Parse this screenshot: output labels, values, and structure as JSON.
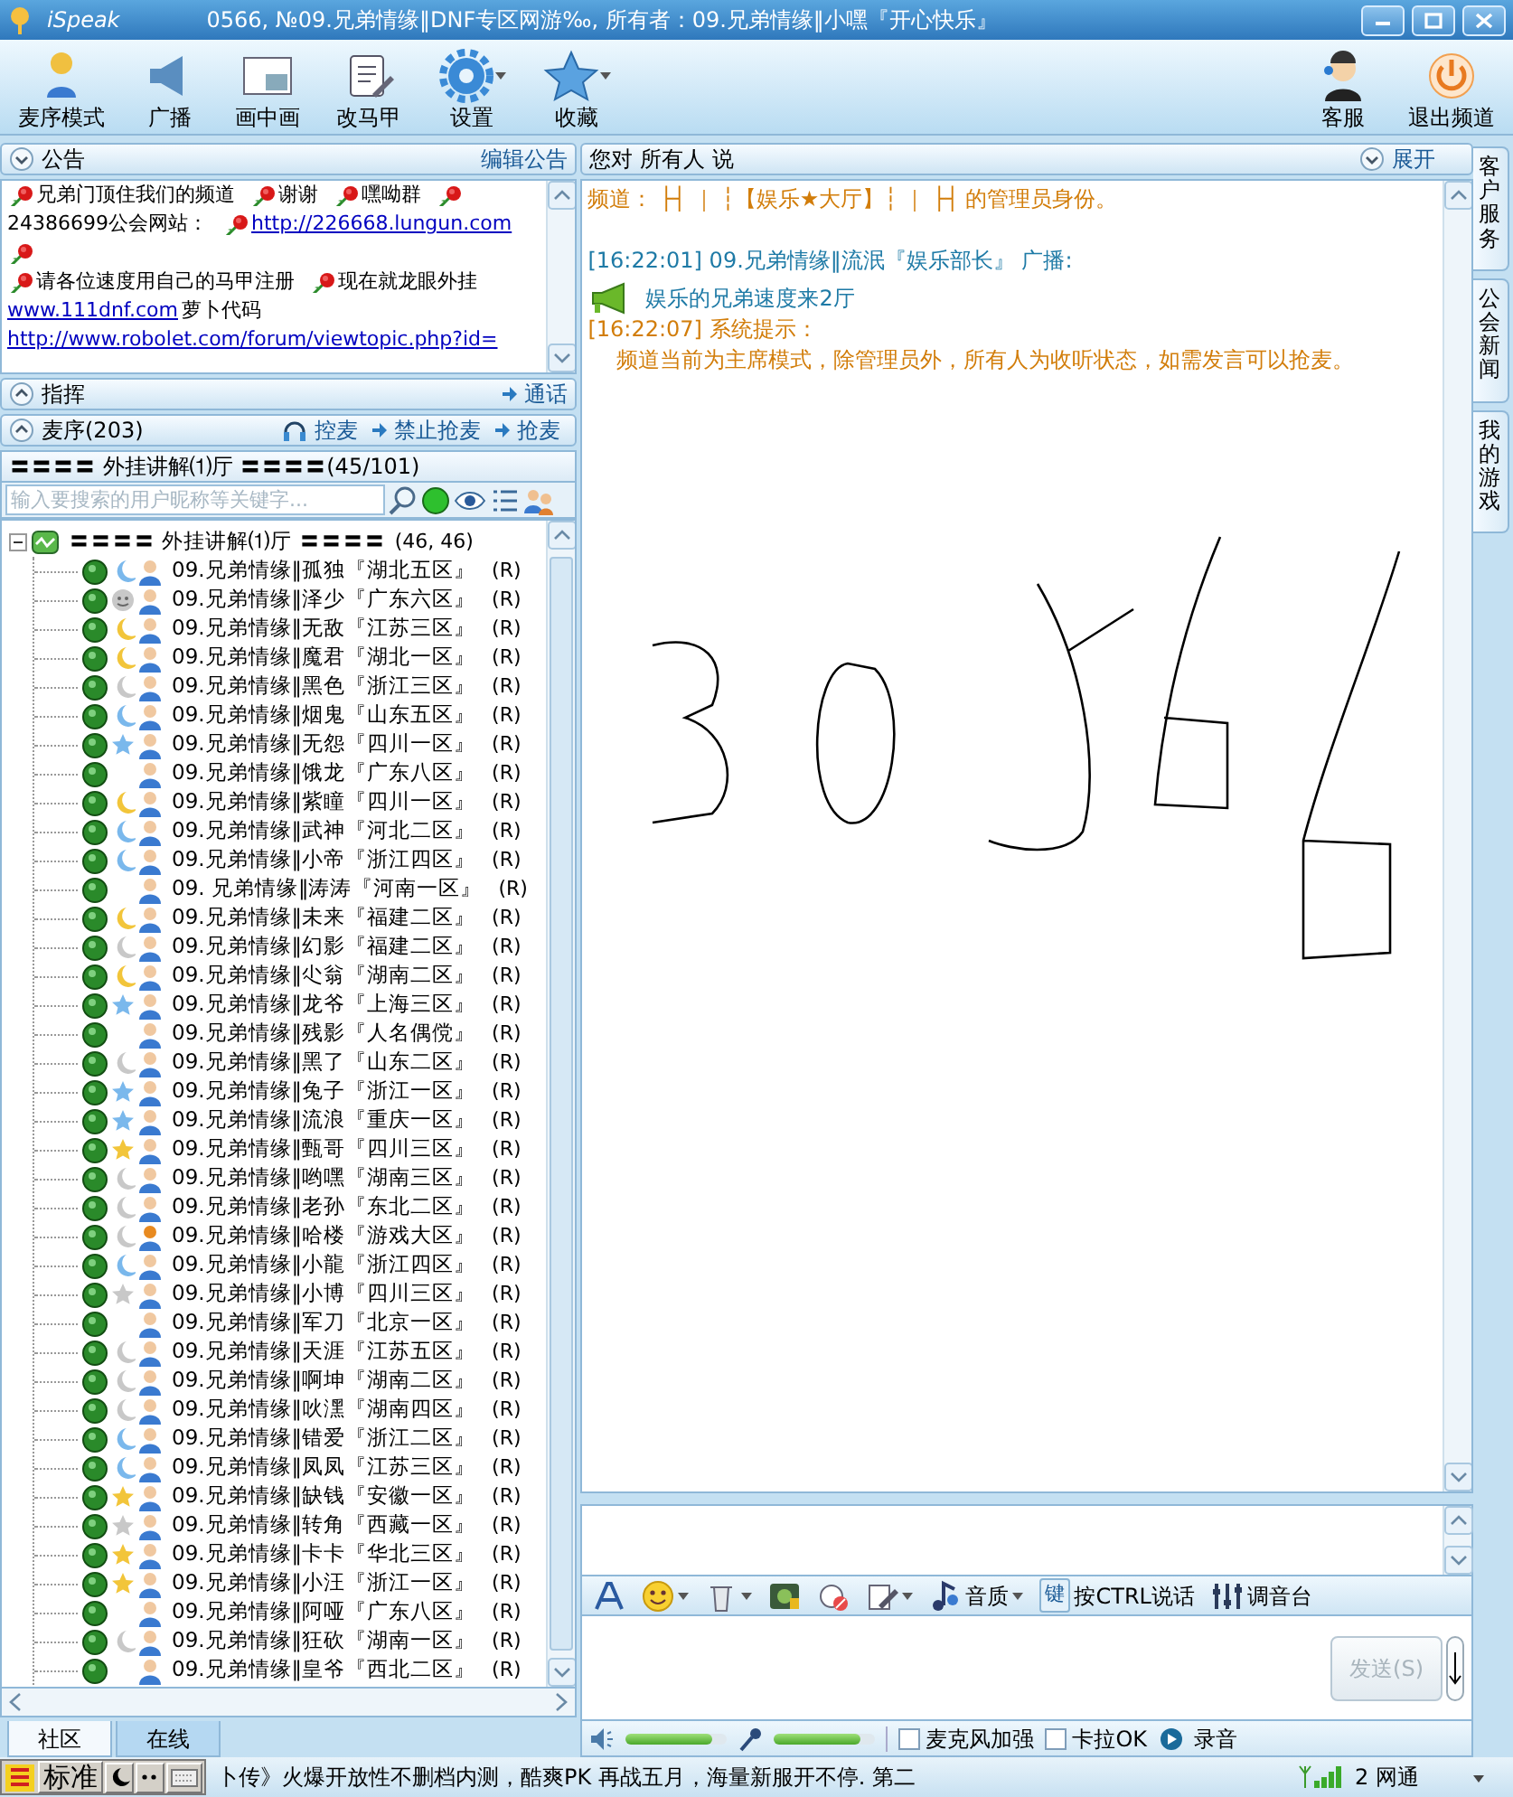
{
  "window": {
    "app_name": "iSpeak",
    "title": "0566, №09.兄弟情缘‖DNF专区网游‰, 所有者：09.兄弟情缘‖小嘿『开心快乐』"
  },
  "toolbar": {
    "left": [
      {
        "kind": "queue",
        "label": "麦序模式",
        "dropdown": false
      },
      {
        "kind": "broadcast",
        "label": "广播",
        "dropdown": false
      },
      {
        "kind": "pip",
        "label": "画中画",
        "dropdown": false
      },
      {
        "kind": "vest",
        "label": "改马甲",
        "dropdown": false
      },
      {
        "kind": "gear",
        "label": "设置",
        "dropdown": true
      },
      {
        "kind": "star",
        "label": "收藏",
        "dropdown": true
      }
    ],
    "right": [
      {
        "kind": "support",
        "label": "客服",
        "dropdown": false
      },
      {
        "kind": "power",
        "label": "退出频道",
        "dropdown": false
      }
    ]
  },
  "announcement": {
    "title": "公告",
    "expanded": true,
    "action": "编辑公告",
    "lines": [
      [
        {
          "kind": "rose"
        },
        {
          "kind": "text",
          "text": "兄弟门顶住我们的频道"
        },
        {
          "kind": "rose"
        },
        {
          "kind": "text",
          "text": "谢谢"
        },
        {
          "kind": "rose"
        },
        {
          "kind": "text",
          "text": "嘿呦群"
        },
        {
          "kind": "rose"
        }
      ],
      [
        {
          "kind": "text",
          "text": "24386699公会网站："
        },
        {
          "kind": "rose"
        },
        {
          "kind": "link",
          "text": "http://226668.lungun.com"
        }
      ],
      [
        {
          "kind": "rose"
        }
      ],
      [
        {
          "kind": "rose"
        },
        {
          "kind": "text",
          "text": "请各位速度用自己的马甲注册"
        },
        {
          "kind": "rose"
        },
        {
          "kind": "text",
          "text": "现在就龙眼外挂"
        }
      ],
      [
        {
          "kind": "link",
          "text": "www.111dnf.com"
        },
        {
          "kind": "text",
          "text": "萝卜代码"
        }
      ],
      [
        {
          "kind": "link",
          "text": "http://www.robolet.com/forum/viewtopic.php?id="
        }
      ]
    ]
  },
  "command": {
    "title": "指挥",
    "expanded": false,
    "action": "通话"
  },
  "queue": {
    "title": "麦序(203)",
    "expanded": false,
    "actions": [
      "控麦",
      "禁止抢麦",
      "抢麦"
    ]
  },
  "channel": {
    "title": "〓〓〓〓 外挂讲解⑴厅 〓〓〓〓(45/101)"
  },
  "search": {
    "placeholder": "输入要搜索的用户昵称等关键字..."
  },
  "tree": {
    "label": "〓〓〓〓 外挂讲解⑴厅 〓〓〓〓",
    "count": "(46, 46)",
    "expanded": true,
    "children": [
      {
        "name": "09.兄弟情缘‖孤独『湖北五区』",
        "tag": "(R)",
        "kind": "moon",
        "color": "#7ab8ec",
        "vip": false
      },
      {
        "name": "09.兄弟情缘‖泽少『广东六区』",
        "tag": "(R)",
        "kind": "smile",
        "color": "#c8c8c8",
        "vip": false
      },
      {
        "name": "09.兄弟情缘‖无敌『江苏三区』",
        "tag": "(R)",
        "kind": "moon",
        "color": "#f2c53a",
        "vip": false
      },
      {
        "name": "09.兄弟情缘‖魔君『湖北一区』",
        "tag": "(R)",
        "kind": "moon",
        "color": "#f2c53a",
        "vip": false
      },
      {
        "name": "09.兄弟情缘‖黑色『浙江三区』",
        "tag": "(R)",
        "kind": "moon",
        "color": "#c8c8c8",
        "vip": false
      },
      {
        "name": "09.兄弟情缘‖烟鬼『山东五区』",
        "tag": "(R)",
        "kind": "moon",
        "color": "#7ab8ec",
        "vip": false
      },
      {
        "name": "09.兄弟情缘‖无怨『四川一区』",
        "tag": "(R)",
        "kind": "star",
        "color": "#7ab8ec",
        "vip": false
      },
      {
        "name": "09.兄弟情缘‖饿龙『广东八区』",
        "tag": "(R)",
        "kind": "plain",
        "vip": false
      },
      {
        "name": "09.兄弟情缘‖紫瞳『四川一区』",
        "tag": "(R)",
        "kind": "moon",
        "color": "#f2c53a",
        "vip": false
      },
      {
        "name": "09.兄弟情缘‖武神『河北二区』",
        "tag": "(R)",
        "kind": "moon",
        "color": "#7ab8ec",
        "vip": false
      },
      {
        "name": "09.兄弟情缘‖小帝『浙江四区』",
        "tag": "(R)",
        "kind": "moon",
        "color": "#7ab8ec",
        "vip": false
      },
      {
        "name": "09. 兄弟情缘‖涛涛『河南一区』",
        "tag": "(R)",
        "kind": "plain",
        "vip": false
      },
      {
        "name": "09.兄弟情缘‖未来『福建二区』",
        "tag": "(R)",
        "kind": "moon",
        "color": "#f2c53a",
        "vip": false
      },
      {
        "name": "09.兄弟情缘‖幻影『福建二区』",
        "tag": "(R)",
        "kind": "moon",
        "color": "#c8c8c8",
        "vip": false
      },
      {
        "name": "09.兄弟情缘‖尐翁『湖南二区』",
        "tag": "(R)",
        "kind": "moon",
        "color": "#f2c53a",
        "vip": false
      },
      {
        "name": "09.兄弟情缘‖龙爷『上海三区』",
        "tag": "(R)",
        "kind": "star",
        "color": "#7ab8ec",
        "vip": false
      },
      {
        "name": "09.兄弟情缘‖残影『人名偶傥』",
        "tag": "(R)",
        "kind": "plain",
        "vip": false
      },
      {
        "name": "09.兄弟情缘‖黑了『山东二区』",
        "tag": "(R)",
        "kind": "moon",
        "color": "#c8c8c8",
        "vip": false
      },
      {
        "name": "09.兄弟情缘‖兔子『浙江一区』",
        "tag": "(R)",
        "kind": "star",
        "color": "#7ab8ec",
        "vip": false
      },
      {
        "name": "09.兄弟情缘‖流浪『重庆一区』",
        "tag": "(R)",
        "kind": "star",
        "color": "#7ab8ec",
        "vip": false
      },
      {
        "name": "09.兄弟情缘‖甄哥『四川三区』",
        "tag": "(R)",
        "kind": "star",
        "color": "#f2c53a",
        "vip": false
      },
      {
        "name": "09.兄弟情缘‖哟嘿『湖南三区』",
        "tag": "(R)",
        "kind": "moon",
        "color": "#c8c8c8",
        "vip": false
      },
      {
        "name": "09.兄弟情缘‖老孙『东北二区』",
        "tag": "(R)",
        "kind": "moon",
        "color": "#c8c8c8",
        "vip": false
      },
      {
        "name": "09.兄弟情缘‖哈楼『游戏大区』",
        "tag": "(R)",
        "kind": "moon",
        "color": "#c8c8c8",
        "vip": true
      },
      {
        "name": "09.兄弟情缘‖小龍『浙江四区』",
        "tag": "(R)",
        "kind": "moon",
        "color": "#7ab8ec",
        "vip": false
      },
      {
        "name": "09.兄弟情缘‖小博『四川三区』",
        "tag": "(R)",
        "kind": "star",
        "color": "#c8c8c8",
        "vip": false
      },
      {
        "name": "09.兄弟情缘‖军刀『北京一区』",
        "tag": "(R)",
        "kind": "plain",
        "vip": false
      },
      {
        "name": "09.兄弟情缘‖天涯『江苏五区』",
        "tag": "(R)",
        "kind": "moon",
        "color": "#c8c8c8",
        "vip": false
      },
      {
        "name": "09.兄弟情缘‖啊坤『湖南二区』",
        "tag": "(R)",
        "kind": "moon",
        "color": "#c8c8c8",
        "vip": false
      },
      {
        "name": "09.兄弟情缘‖吙潶『湖南四区』",
        "tag": "(R)",
        "kind": "moon",
        "color": "#c8c8c8",
        "vip": false
      },
      {
        "name": "09.兄弟情缘‖错爱『浙江二区』",
        "tag": "(R)",
        "kind": "moon",
        "color": "#7ab8ec",
        "vip": false
      },
      {
        "name": "09.兄弟情缘‖凤凤『江苏三区』",
        "tag": "(R)",
        "kind": "moon",
        "color": "#7ab8ec",
        "vip": false
      },
      {
        "name": "09.兄弟情缘‖缺钱『安徽一区』",
        "tag": "(R)",
        "kind": "star",
        "color": "#f2c53a",
        "vip": false
      },
      {
        "name": "09.兄弟情缘‖转角『西藏一区』",
        "tag": "(R)",
        "kind": "star",
        "color": "#c8c8c8",
        "vip": false
      },
      {
        "name": "09.兄弟情缘‖卡卡『华北三区』",
        "tag": "(R)",
        "kind": "star",
        "color": "#f2c53a",
        "vip": false
      },
      {
        "name": "09.兄弟情缘‖小汪『浙江一区』",
        "tag": "(R)",
        "kind": "star",
        "color": "#f2c53a",
        "vip": false
      },
      {
        "name": "09.兄弟情缘‖阿哑『广东八区』",
        "tag": "(R)",
        "kind": "plain",
        "vip": false
      },
      {
        "name": "09.兄弟情缘‖狂砍『湖南一区』",
        "tag": "(R)",
        "kind": "moon",
        "color": "#c8c8c8",
        "vip": false
      },
      {
        "name": "09.兄弟情缘‖皇爷『西北二区』",
        "tag": "(R)",
        "kind": "plain",
        "vip": false
      }
    ]
  },
  "left_tabs": [
    {
      "label": "社区",
      "selected": false
    },
    {
      "label": "在线",
      "selected": true
    }
  ],
  "chat": {
    "target": "您对 所有人 说",
    "expand": "展开",
    "messages": [
      {
        "kind": "notice",
        "label": "频道：",
        "text": "├┤ ｜ ┆【娱乐★大厅】┆ ｜ ├┤ 的管理员身份。"
      },
      {
        "kind": "broadcast",
        "text": "[16:22:01] 09.兄弟情缘‖流泯『娱乐部长』 广播:"
      },
      {
        "kind": "megaphone",
        "text": "娱乐的兄弟速度来2厅"
      },
      {
        "kind": "system",
        "text": "[16:22:07] 系统提示："
      },
      {
        "kind": "system_body",
        "text": "频道当前为主席模式，除管理员外，所有人为收听状态，如需发言可以抢麦。"
      }
    ]
  },
  "input_toolbar": [
    {
      "kind": "font",
      "dropdown": false
    },
    {
      "kind": "emoji",
      "dropdown": true
    },
    {
      "kind": "trash",
      "dropdown": true
    },
    {
      "kind": "picture",
      "dropdown": false
    },
    {
      "kind": "no-chat",
      "dropdown": false
    },
    {
      "kind": "pen",
      "dropdown": true
    },
    {
      "kind": "quality",
      "label": "音质",
      "dropdown": true
    },
    {
      "kind": "key",
      "badge": "键",
      "label": "按CTRL说话",
      "dropdown": false
    },
    {
      "kind": "mixer",
      "label": "调音台",
      "dropdown": false
    }
  ],
  "send_button": {
    "label": "发送(S)",
    "disabled": true
  },
  "audio": {
    "speaker": {
      "level": 0.85
    },
    "mic": {
      "level": 0.85
    },
    "options": [
      {
        "label": "麦克风加强",
        "checked": false
      },
      {
        "label": "卡拉OK",
        "checked": false
      }
    ],
    "record": "录音"
  },
  "side_tabs": [
    {
      "label": "客户服务"
    },
    {
      "label": "公会新闻"
    },
    {
      "label": "我的游戏"
    }
  ],
  "status_bar": {
    "ime": "标准",
    "ticker": "卜传》火爆开放性不删档内测，酷爽PK 再战五月，海量新服开不停.  第二",
    "network": "2 网通"
  }
}
